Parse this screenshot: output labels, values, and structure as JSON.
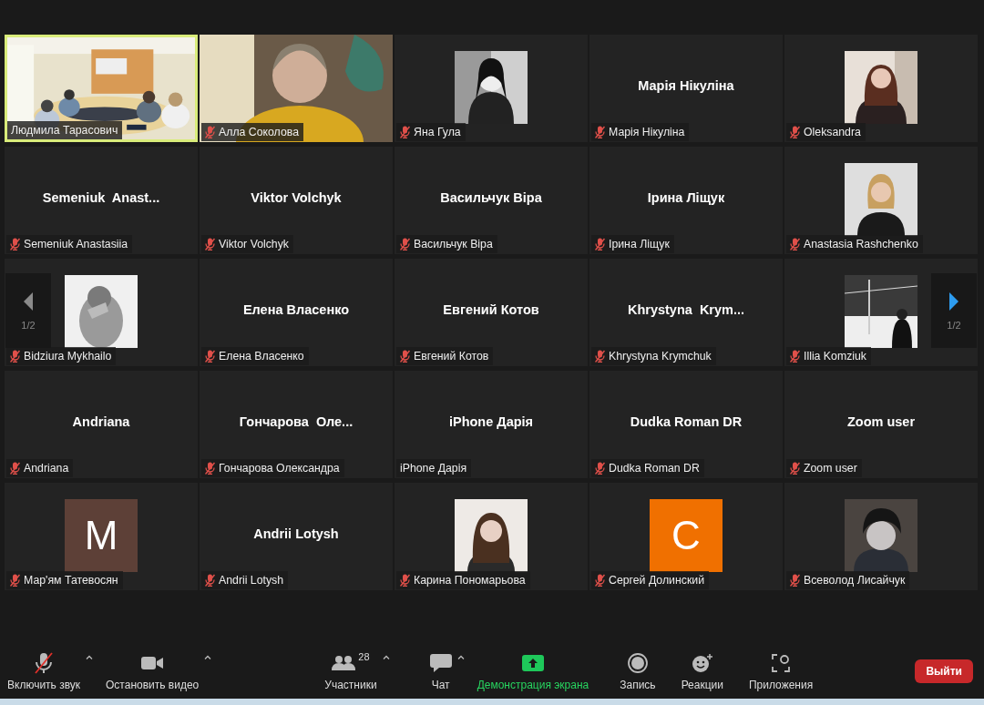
{
  "tiles": [
    {
      "kind": "video",
      "label": "Людмила Тарасович",
      "muted": false,
      "speaking": true
    },
    {
      "kind": "video",
      "label": "Алла Соколова",
      "muted": true,
      "speaking": false
    },
    {
      "label": "Яна Гула",
      "muted": true,
      "speaking": false
    },
    {
      "kind": "name",
      "display_name": "Марія Нікуліна",
      "label": "Марія Нікуліна",
      "muted": true,
      "speaking": false
    },
    {
      "label": "Oleksandra",
      "muted": true,
      "speaking": false
    },
    {
      "kind": "name",
      "display_name": "Semeniuk  Anast...",
      "label": "Semeniuk Anastasiia",
      "muted": true,
      "speaking": false
    },
    {
      "kind": "name",
      "display_name": "Viktor Volchyk",
      "label": "Viktor Volchyk",
      "muted": true,
      "speaking": false
    },
    {
      "kind": "name",
      "display_name": "Васильчук Віра",
      "label": "Васильчук Віра",
      "muted": true,
      "speaking": false
    },
    {
      "kind": "name",
      "display_name": "Ірина Ліщук",
      "label": "Ірина Ліщук",
      "muted": true,
      "speaking": false
    },
    {
      "label": "Anastasia Rashchenko",
      "muted": true,
      "speaking": false
    },
    {
      "label": "Bidziura Mykhailo",
      "muted": true,
      "speaking": false
    },
    {
      "kind": "name",
      "display_name": "Елена Власенко",
      "label": "Елена Власенко",
      "muted": true,
      "speaking": false
    },
    {
      "kind": "name",
      "display_name": "Евгений Котов",
      "label": "Евгений Котов",
      "muted": true,
      "speaking": false
    },
    {
      "kind": "name",
      "display_name": "Khrystyna  Krym...",
      "label": "Khrystyna Krymchuk",
      "muted": true,
      "speaking": false
    },
    {
      "label": "Illia Komziuk",
      "muted": true,
      "speaking": false
    },
    {
      "kind": "name",
      "display_name": "Andriana",
      "label": "Andriana",
      "muted": true,
      "speaking": false
    },
    {
      "kind": "name",
      "display_name": "Гончарова  Оле...",
      "label": "Гончарова Олександра",
      "muted": true,
      "speaking": false
    },
    {
      "kind": "name",
      "display_name": "iPhone Дарія",
      "label": "iPhone Дарія",
      "muted": false,
      "speaking": false
    },
    {
      "kind": "name",
      "display_name": "Dudka Roman DR",
      "label": "Dudka Roman DR",
      "muted": true,
      "speaking": false
    },
    {
      "kind": "name",
      "display_name": "Zoom user",
      "label": "Zoom user",
      "muted": true,
      "speaking": false
    },
    {
      "kind": "initial",
      "initial": "M",
      "color": "#5d4037",
      "label": "Мар'ям Татевосян",
      "muted": true,
      "speaking": false
    },
    {
      "kind": "name",
      "display_name": "Andrii Lotysh",
      "label": "Andrii Lotysh",
      "muted": true,
      "speaking": false
    },
    {
      "label": "Карина Пономарьова",
      "muted": true,
      "speaking": false
    },
    {
      "kind": "initial",
      "initial": "C",
      "color": "#f07000",
      "label": "Сергей Долинский",
      "muted": true,
      "speaking": false
    },
    {
      "label": "Всеволод Лисайчук",
      "muted": true,
      "speaking": false
    }
  ],
  "pager": {
    "previous": {
      "page": "1/2",
      "disabled": true
    },
    "next": {
      "page": "1/2",
      "disabled": false
    }
  },
  "toolbar": {
    "items": [
      {
        "kind": "mic",
        "label": "Включить звук",
        "muted": true,
        "caret": true
      },
      {
        "kind": "camera",
        "label": "Остановить видео",
        "caret": true
      },
      {
        "kind": "participants",
        "label": "Участники",
        "count": "28",
        "caret": true
      },
      {
        "kind": "chat",
        "label": "Чат",
        "caret": true
      },
      {
        "kind": "share",
        "label": "Демонстрация экрана",
        "highlighted": true,
        "caret": false
      },
      {
        "kind": "record",
        "label": "Запись",
        "caret": false
      },
      {
        "kind": "reactions",
        "label": "Реакции",
        "caret": false
      },
      {
        "kind": "apps",
        "label": "Приложения",
        "caret": false
      }
    ],
    "leave_button": "Выйти"
  }
}
